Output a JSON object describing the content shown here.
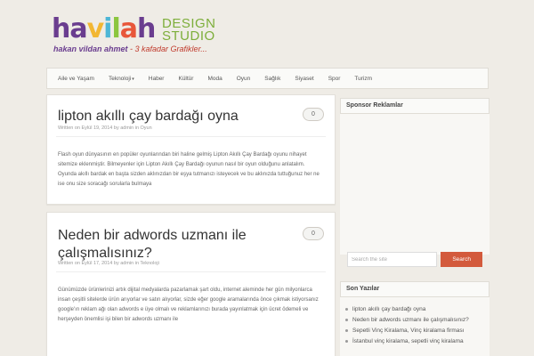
{
  "logo": {
    "word_parts": [
      "ha",
      "v",
      "i",
      "l",
      "a",
      "h"
    ],
    "design_line1": "DESIGN",
    "design_line2": "STUDIO",
    "tagline_names": "hakan vildan ahmet",
    "tagline_rest": " - 3 kafadar Grafikler..."
  },
  "nav": {
    "items": [
      {
        "label": "Aile ve Yaşam"
      },
      {
        "label": "Teknoloji",
        "caret": "▾"
      },
      {
        "label": "Haber"
      },
      {
        "label": "Kültür"
      },
      {
        "label": "Moda"
      },
      {
        "label": "Oyun"
      },
      {
        "label": "Sağlık"
      },
      {
        "label": "Siyaset"
      },
      {
        "label": "Spor"
      },
      {
        "label": "Turizm"
      }
    ]
  },
  "posts": [
    {
      "title": "lipton akıllı çay bardağı oyna",
      "meta": "Written on Eylül 19, 2014 by admin in Oyun",
      "comments": "0",
      "excerpt": "Flash oyun dünyasının en popüler oyunlarından biri haline gelmiş Lipton Akıllı Çay Bardağı oyunu nihayet sitemize eklenmiştir. Bilmeyenler için Lipton Akıllı Çay Bardağı oyunun nasıl bir oyun olduğunu anlatalım. Oyunda akıllı bardak en başta sizden aklınızdan bir eşya tutmanızı isteyecek ve bu aklınızda tuttuğunuz her ne ise onu size soracağı sorularla bulmaya"
    },
    {
      "title": "Neden bir adwords uzmanı ile çalışmalısınız?",
      "meta": "Written on Eylül 17, 2014 by admin in Teknoloji",
      "comments": "0",
      "excerpt": "Günümüzde ürünlerinizi artık dijital medyalarda pazarlamak şart oldu, internet aleminde her gün milyonlarca insan çeşitli sitelerde ürün arıyorlar ve satın alıyorlar, sizde eğer google aramalarında önce çıkmak istiyorsanız google'ın reklam ağı olan adwords e üye olmalı ve reklamlarınızı burada yayınlatmak için ücret ödemeli ve herşeyden önemlisi işi bilen bir adwords uzmanı ile"
    }
  ],
  "sidebar": {
    "sponsor_title": "Sponsor Reklamlar",
    "search_placeholder": "Search the site",
    "search_button": "Search",
    "recent_title": "Son Yazılar",
    "recent_items": [
      "lipton akıllı çay bardağı oyna",
      "Neden bir adwords uzmanı ile çalışmalısınız?",
      "Sepetli Vinç Kiralama, Vinç kiralama firması",
      "İstanbul vinç kiralama, sepetli vinç kiralama"
    ]
  },
  "colors": {
    "accent": "#d35a3c",
    "background": "#efece6"
  }
}
